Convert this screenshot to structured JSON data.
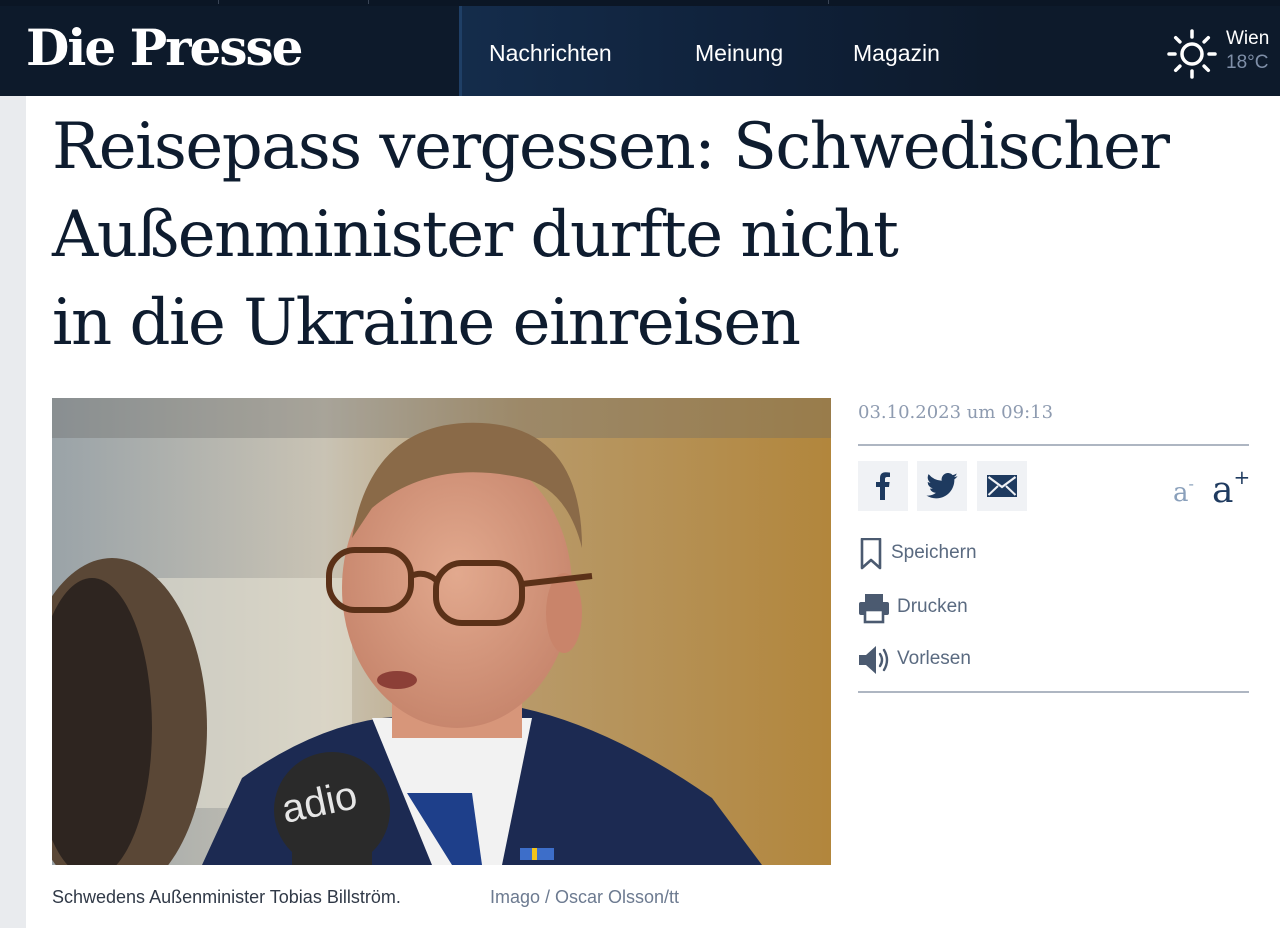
{
  "header": {
    "logo": "Die Presse",
    "nav": [
      "Nachrichten",
      "Meinung",
      "Magazin"
    ],
    "weather": {
      "city": "Wien",
      "temp": "18°C",
      "icon": "sun-icon"
    }
  },
  "article": {
    "headline_lines": [
      "Reisepass vergessen: Schwedischer",
      "Außenminister durfte nicht",
      "in die Ukraine einreisen"
    ],
    "caption": "Schwedens Außenminister Tobias Billström.",
    "credit": "Imago / Oscar Olsson/tt",
    "microphone_text": "adio"
  },
  "sidebar": {
    "date": "03.10.2023 um 09:13",
    "share": [
      "facebook-icon",
      "twitter-icon",
      "mail-icon"
    ],
    "font_decrease": "a",
    "font_decrease_sup": "-",
    "font_increase": "a",
    "font_increase_sup": "+",
    "actions": {
      "save": "Speichern",
      "print": "Drucken",
      "read": "Vorlesen"
    }
  },
  "colors": {
    "header_bg": "#0d1a2b",
    "headline": "#0e1c2f",
    "accent": "#1e3a5f",
    "muted": "#5a6a80"
  }
}
